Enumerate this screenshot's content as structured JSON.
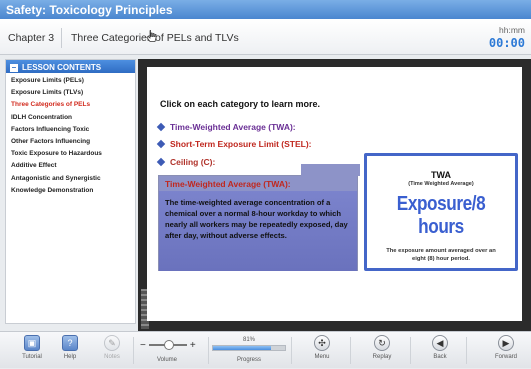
{
  "app": {
    "title": "Safety: Toxicology Principles"
  },
  "header": {
    "chapter": "Chapter 3",
    "lesson_title": "Three Categories of PELs and TLVs",
    "time_label": "hh:mm",
    "time_value": "00:00"
  },
  "sidebar": {
    "heading": "LESSON CONTENTS",
    "items": [
      {
        "label": "Exposure Limits (PELs)"
      },
      {
        "label": "Exposure Limits (TLVs)"
      },
      {
        "label": "Three Categories of PELs",
        "active": true
      },
      {
        "label": "IDLH Concentration"
      },
      {
        "label": "Factors Influencing Toxic"
      },
      {
        "label": "Other Factors Influencing"
      },
      {
        "label": "Toxic Exposure to Hazardous"
      },
      {
        "label": "Additive Effect"
      },
      {
        "label": "Antagonistic and Synergistic"
      },
      {
        "label": "Knowledge Demonstration"
      }
    ]
  },
  "slide": {
    "prompt": "Click on each category to learn more.",
    "categories": [
      {
        "label": "Time-Weighted Average (TWA):"
      },
      {
        "label": "Short-Term Exposure Limit (STEL):"
      },
      {
        "label": "Ceiling (C):"
      }
    ],
    "definition": {
      "title": "Time-Weighted Average (TWA):",
      "body": "The time-weighted average concentration of a chemical over a normal 8-hour workday to which nearly all workers may be repeatedly exposed, day after day, without adverse effects."
    },
    "card": {
      "abbr": "TWA",
      "full": "(Time Weighted Average)",
      "headline": "Exposure/8 hours",
      "note": "The exposure amount averaged over an eight (8) hour period."
    }
  },
  "toolbar": {
    "tutorial": "Tutorial",
    "help": "Help",
    "notes": "Notes",
    "volume": "Volume",
    "progress_label": "Progress",
    "progress_pct": "81%",
    "progress_value": 0.81,
    "menu": "Menu",
    "replay": "Replay",
    "back": "Back",
    "forward": "Forward"
  },
  "colors": {
    "accent": "#2d7ad6",
    "active_item": "#d22b1e",
    "definition_bg": "#6e76c2"
  }
}
